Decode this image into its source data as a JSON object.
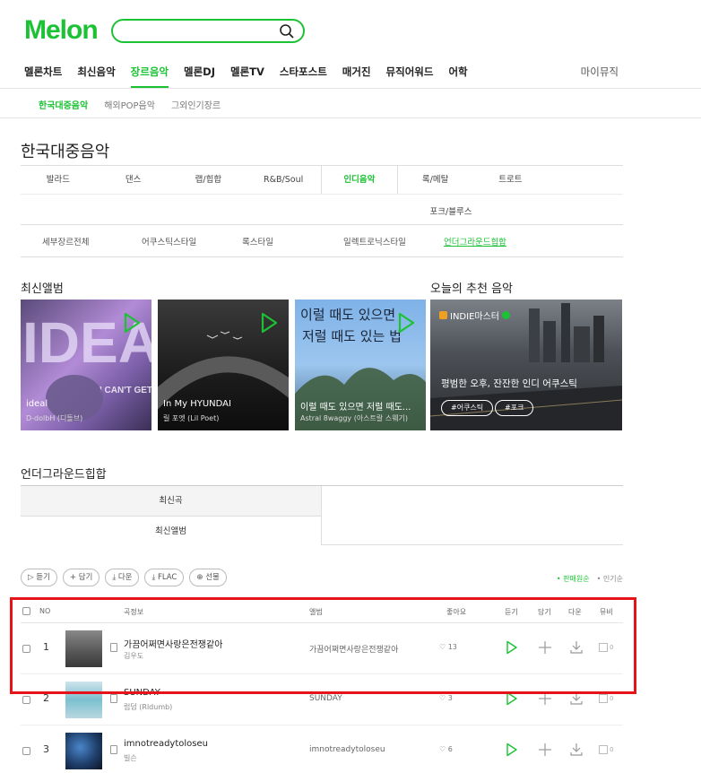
{
  "header": {
    "logo": "Melon",
    "search_placeholder": "",
    "gnb": [
      "멜론차트",
      "최신음악",
      "장르음악",
      "멜론DJ",
      "멜론TV",
      "스타포스트",
      "매거진",
      "뮤직어워드",
      "어학"
    ],
    "gnb_active": 2,
    "mymusic": "마이뮤직"
  },
  "subnav": [
    "한국대중음악",
    "해외POP음악",
    "그외인기장르"
  ],
  "page_title": "한국대중음악",
  "genres": [
    "발라드",
    "댄스",
    "랩/힙합",
    "R&B/Soul",
    "인디음악",
    "록/메탈",
    "트로트"
  ],
  "genre_row2": "포크/블루스",
  "genre_sub": [
    "세부장르전체",
    "어쿠스틱스타일",
    "록스타일",
    "일렉트로닉스타일",
    "언더그라운드힙합"
  ],
  "sections": {
    "latest": "최신앨범",
    "recommend": "오늘의 추천 음악",
    "underground": "언더그라운드힙합"
  },
  "albums": [
    {
      "name": "ideal",
      "artist": "D-dolbH (디돌브)"
    },
    {
      "name": "In My HYUNDAI",
      "artist": "릴 포엣 (Lil Poet)"
    },
    {
      "name": "이럴 때도 있으면 저럴 때도...",
      "artist": "Astral 8waggy (아스트랄 스웨기)"
    }
  ],
  "album_art_text": {
    "a1_main": "IDEAL",
    "a1_sub": "I CAN'T GET OVER THIS",
    "a3_line1": "이럴 때도 있으면",
    "a3_line2": "저럴 때도 있는 법"
  },
  "recommend": {
    "badge": "INDIE마스터",
    "title": "평범한 오후, 잔잔한 인디 어쿠스틱",
    "tags": [
      "#어쿠스틱",
      "#포크"
    ]
  },
  "ug_tabs": [
    "최신곡",
    "최신앨범"
  ],
  "buttons": [
    "듣기",
    "+ 담기",
    "다운",
    "FLAC",
    "선물"
  ],
  "sort": [
    "판매원순",
    "인기순"
  ],
  "table_headers": {
    "no": "NO",
    "song": "곡정보",
    "album": "앨범",
    "like": "좋아요",
    "listen": "듣기",
    "add": "담기",
    "down": "다운",
    "video": "뮤비"
  },
  "songs": [
    {
      "rank": "1",
      "title": "가끔어쩌면사랑은전쟁같아",
      "artist": "김우도",
      "album": "가끔어쩌면사랑은전쟁같아",
      "likes": "13",
      "video": "0"
    },
    {
      "rank": "2",
      "title": "SUNDAY",
      "artist": "럽덤 (Rldumb)",
      "album": "SUNDAY",
      "likes": "3",
      "video": "0"
    },
    {
      "rank": "3",
      "title": "imnotreadytoloseu",
      "artist": "빌슨",
      "album": "imnotreadytoloseu",
      "likes": "6",
      "video": "0"
    }
  ],
  "colors": {
    "brand": "#1bc234",
    "highlight": "#e5131a"
  }
}
